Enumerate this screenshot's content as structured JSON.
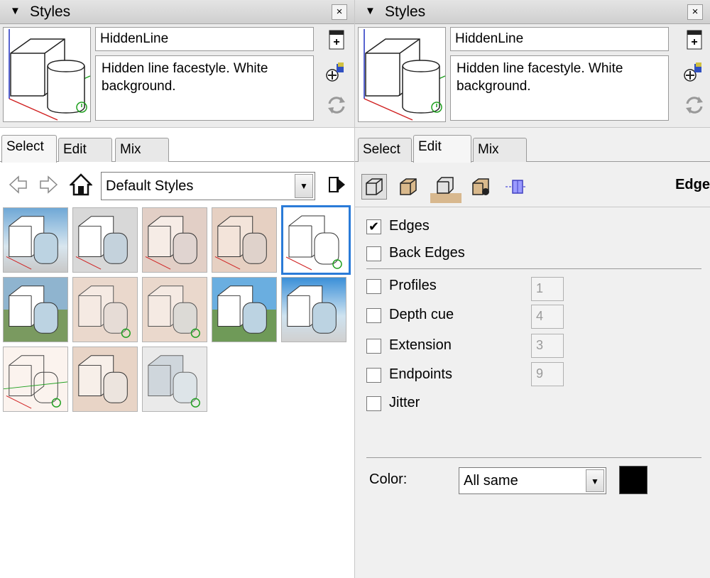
{
  "left_panel": {
    "title": "Styles",
    "close_glyph": "×",
    "style_name": "HiddenLine",
    "style_description": "Hidden line facestyle. White background.",
    "tabs": [
      "Select",
      "Edit",
      "Mix"
    ],
    "active_tab": "Select",
    "collection": "Default Styles",
    "nav_icons": [
      "back-arrow-icon",
      "forward-arrow-icon",
      "home-icon",
      "details-arrow-icon"
    ],
    "selected_style_index": 4
  },
  "right_panel": {
    "title": "Styles",
    "close_glyph": "×",
    "style_name": "HiddenLine",
    "style_description": "Hidden line facestyle. White background.",
    "tabs": [
      "Select",
      "Edit",
      "Mix"
    ],
    "active_tab": "Edit",
    "section_label": "Edge",
    "tool_icons": [
      "edge-settings-icon",
      "face-settings-icon",
      "background-settings-icon",
      "watermark-settings-icon",
      "modeling-settings-icon"
    ],
    "edge_options": [
      {
        "label": "Edges",
        "checked": true
      },
      {
        "label": "Back Edges",
        "checked": false
      }
    ],
    "edge_effects": [
      {
        "label": "Profiles",
        "checked": false,
        "value": "1"
      },
      {
        "label": "Depth cue",
        "checked": false,
        "value": "4"
      },
      {
        "label": "Extension",
        "checked": false,
        "value": "3"
      },
      {
        "label": "Endpoints",
        "checked": false,
        "value": "9"
      },
      {
        "label": "Jitter",
        "checked": false
      }
    ],
    "color_label": "Color:",
    "color_mode": "All same",
    "edge_color": "#000000"
  },
  "check_glyph": "✔",
  "colors": {
    "selection_border": "#2a7bd8",
    "axis_red": "#d02020",
    "axis_green": "#20a020",
    "axis_blue": "#2030c0"
  }
}
